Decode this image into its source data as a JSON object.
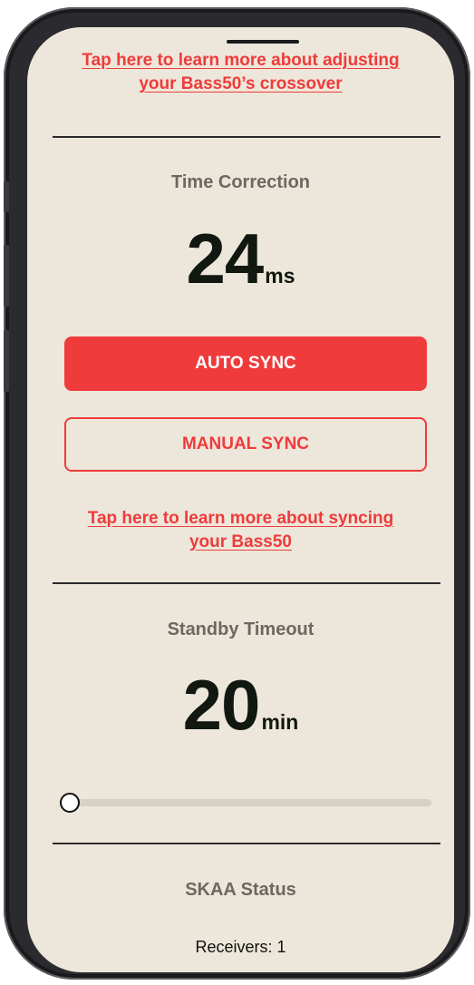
{
  "crossover_link": {
    "line1": "Tap here to learn more about adjusting",
    "line2": "your Bass50’s crossover"
  },
  "time_correction": {
    "title": "Time Correction",
    "value": "24",
    "unit": "ms"
  },
  "buttons": {
    "auto_sync": "AUTO SYNC",
    "manual_sync": "MANUAL SYNC"
  },
  "sync_link": {
    "line1": "Tap here to learn more about syncing",
    "line2": "your Bass50"
  },
  "standby_timeout": {
    "title": "Standby Timeout",
    "value": "20",
    "unit": "min",
    "slider_fraction": 0.0
  },
  "skaa_status": {
    "title": "SKAA Status",
    "receivers": "Receivers: 1"
  },
  "colors": {
    "accent": "#ef3b3b",
    "background": "#ede6da",
    "text_dark": "#101810",
    "title_gray": "#6c6862"
  }
}
